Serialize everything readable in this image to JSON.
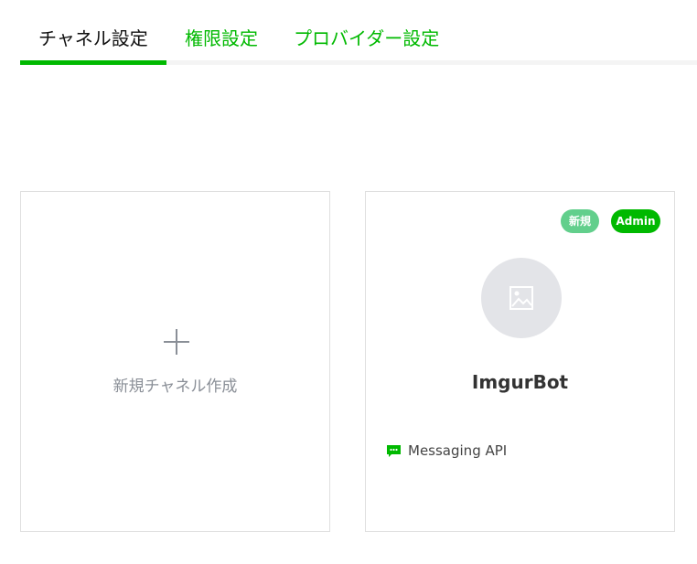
{
  "tabs": [
    {
      "label": "チャネル設定",
      "active": true
    },
    {
      "label": "権限設定",
      "active": false
    },
    {
      "label": "プロバイダー設定",
      "active": false
    }
  ],
  "new_channel": {
    "label": "新規チャネル作成",
    "icon": "plus-icon"
  },
  "channels": [
    {
      "name": "ImgurBot",
      "badges": [
        "新規",
        "Admin"
      ],
      "type": "Messaging API",
      "type_icon": "chat-bubble-icon",
      "avatar_icon": "image-placeholder-icon"
    }
  ],
  "colors": {
    "accent": "#00b900",
    "badge_new": "#62cf8c",
    "avatar_bg": "#e3e4e8"
  }
}
